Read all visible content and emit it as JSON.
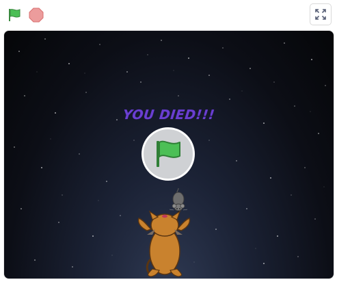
{
  "controls": {
    "green_flag_icon": "green-flag-icon",
    "stop_icon": "stop-sign-icon",
    "fullscreen_icon": "fullscreen-icon"
  },
  "stage": {
    "message": "YOU DIED!!!",
    "play_icon": "green-flag-icon",
    "sprites": [
      "mouse",
      "cat"
    ]
  },
  "colors": {
    "flag_green": "#4cbf56",
    "stop_red": "#ec9c9c",
    "message_purple": "#6a3fd1",
    "cat_orange": "#c9822e"
  }
}
